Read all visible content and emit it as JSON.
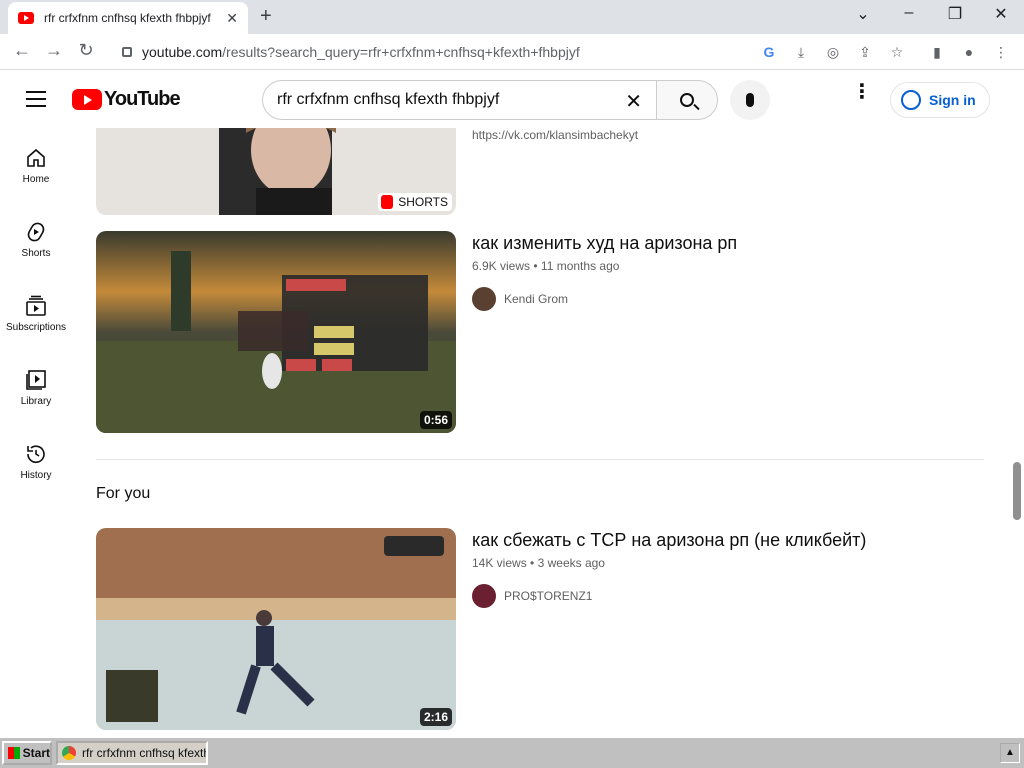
{
  "browser": {
    "tab_title": "rfr crfxfnm cnfhsq kfexth fhbpjyf",
    "url_host": "youtube.com",
    "url_path": "/results?search_query=rfr+crfxfnm+cnfhsq+kfexth+fhbpjyf"
  },
  "header": {
    "logo_text": "YouTube",
    "search_value": "rfr crfxfnm cnfhsq kfexth fhbpjyf",
    "signin_label": "Sign in"
  },
  "sidebar": {
    "items": [
      {
        "label": "Home",
        "icon": "home-icon"
      },
      {
        "label": "Shorts",
        "icon": "shorts-icon"
      },
      {
        "label": "Subscriptions",
        "icon": "subscriptions-icon"
      },
      {
        "label": "Library",
        "icon": "library-icon"
      },
      {
        "label": "History",
        "icon": "history-icon"
      }
    ]
  },
  "results": {
    "top_partial": {
      "description": "https://vk.com/klansimbachekyt",
      "badge": "SHORTS"
    },
    "video1": {
      "title": "как изменить худ на аризона рп",
      "views": "6.9K views",
      "age": "11 months ago",
      "channel": "Kendi Grom",
      "duration": "0:56"
    },
    "section_title": "For you",
    "video2": {
      "title": "как сбежать с ТСР на аризона рп (не кликбейт)",
      "views": "14K views",
      "age": "3 weeks ago",
      "channel": "PRO$TORENZ1",
      "duration": "2:16"
    },
    "meta_separator": "•"
  },
  "taskbar": {
    "start_label": "Start",
    "window_label": "rfr crfxfnm cnfhsq kfexth..."
  },
  "colors": {
    "brand_red": "#ff0000",
    "link_blue": "#065fd4"
  }
}
